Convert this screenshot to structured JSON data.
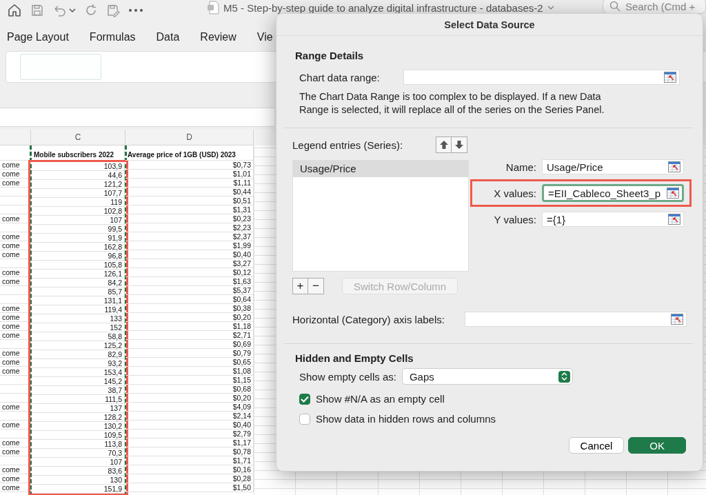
{
  "title_bar": {
    "document_title": "M5 - Step-by-step guide to analyze digital infrastructure - databases-2",
    "search": {
      "placeholder": "Search (Cmd +"
    }
  },
  "ribbon": {
    "tabs": [
      {
        "label": "Page Layout"
      },
      {
        "label": "Formulas"
      },
      {
        "label": "Data"
      },
      {
        "label": "Review"
      },
      {
        "label": "Vie"
      }
    ]
  },
  "sheet": {
    "column_headers": [
      "C",
      "D"
    ],
    "header_row": [
      "Mobile subscribers 2022",
      "Average price of 1GB (USD) 2023"
    ],
    "column_c": {
      "marquee": true,
      "highlighted": true
    },
    "rows": [
      {
        "b": "come",
        "c": "103,9",
        "d": "$0,73"
      },
      {
        "b": "come",
        "c": "44,6",
        "d": "$1,01"
      },
      {
        "b": "come",
        "c": "121,2",
        "d": "$1,11"
      },
      {
        "c": "107,7",
        "d": "$0,44"
      },
      {
        "c": "119",
        "d": "$0,51"
      },
      {
        "c": "102,8",
        "d": "$1,31"
      },
      {
        "b": "come",
        "c": "107",
        "d": "$0,23"
      },
      {
        "c": "99,5",
        "d": "$2,23"
      },
      {
        "b": "come",
        "c": "91,9",
        "d": "$2,37"
      },
      {
        "b": "come",
        "c": "162,8",
        "d": "$1,99"
      },
      {
        "b": "come",
        "c": "96,8",
        "d": "$0,40"
      },
      {
        "c": "105,8",
        "d": "$3,27"
      },
      {
        "b": "come",
        "c": "126,1",
        "d": "$0,12"
      },
      {
        "b": "come",
        "c": "84,2",
        "d": "$1,63"
      },
      {
        "c": "85,7",
        "d": "$5,37"
      },
      {
        "c": "131,1",
        "d": "$0,64"
      },
      {
        "b": "come",
        "c": "119,4",
        "d": "$0,38"
      },
      {
        "b": "come",
        "c": "133",
        "d": "$0,20"
      },
      {
        "b": "come",
        "c": "152",
        "d": "$1,18"
      },
      {
        "b": "come",
        "c": "58,8",
        "d": "$2,71"
      },
      {
        "c": "125,2",
        "d": "$0,69"
      },
      {
        "b": "come",
        "c": "82,9",
        "d": "$0,79"
      },
      {
        "b": "come",
        "c": "93,2",
        "d": "$0,65"
      },
      {
        "b": "come",
        "c": "153,4",
        "d": "$1,08"
      },
      {
        "c": "145,2",
        "d": "$1,15"
      },
      {
        "c": "38,7",
        "d": "$0,68"
      },
      {
        "c": "111,5",
        "d": "$0,20"
      },
      {
        "b": "come",
        "c": "137",
        "d": "$4,09"
      },
      {
        "c": "128,2",
        "d": "$2,14"
      },
      {
        "b": "come",
        "c": "130,2",
        "d": "$0,40"
      },
      {
        "c": "109,5",
        "d": "$2,79"
      },
      {
        "b": "come",
        "c": "113,8",
        "d": "$1,17"
      },
      {
        "b": "come",
        "c": "70,3",
        "d": "$0,78"
      },
      {
        "c": "107",
        "d": "$1,71"
      },
      {
        "b": "come",
        "c": "83,6",
        "d": "$0,16"
      },
      {
        "b": "come",
        "c": "130",
        "d": "$0,28"
      },
      {
        "b": "come",
        "c": "151,9",
        "d": "$1,50"
      }
    ]
  },
  "dialog": {
    "title": "Select Data Source",
    "range_details": {
      "heading": "Range Details",
      "chart_data_range": {
        "label": "Chart data range:"
      },
      "note": "The Chart Data Range is too complex to be displayed. If a new Data Range is selected, it will replace all of the series on the Series Panel."
    },
    "series": {
      "label": "Legend entries (Series):",
      "entries": [
        {
          "label": "Usage/Price",
          "selected": true
        }
      ],
      "add": "+",
      "remove": "−",
      "switch": {
        "label": "Switch Row/Column",
        "disabled": true
      }
    },
    "fields": [
      {
        "label": "Name:",
        "value": "Usage/Price",
        "focused": false,
        "highlighted": false
      },
      {
        "label": "X values:",
        "value": "=EII_Cableco_Sheet3_p",
        "focused": true,
        "highlighted": true
      },
      {
        "label": "Y values:",
        "value": "={1}",
        "focused": false,
        "highlighted": false
      }
    ],
    "axis_labels": {
      "label": "Horizontal (Category) axis labels:"
    },
    "hidden_cells": {
      "heading": "Hidden and Empty Cells",
      "show_empty": {
        "label": "Show empty cells as:",
        "value": "Gaps"
      },
      "options": [
        {
          "label": "Show #N/A as an empty cell",
          "checked": true
        },
        {
          "label": "Show data in hidden rows and columns",
          "checked": false
        }
      ]
    },
    "buttons": [
      {
        "label": "Cancel",
        "kind": "secondary"
      },
      {
        "label": "OK",
        "kind": "primary"
      }
    ]
  }
}
